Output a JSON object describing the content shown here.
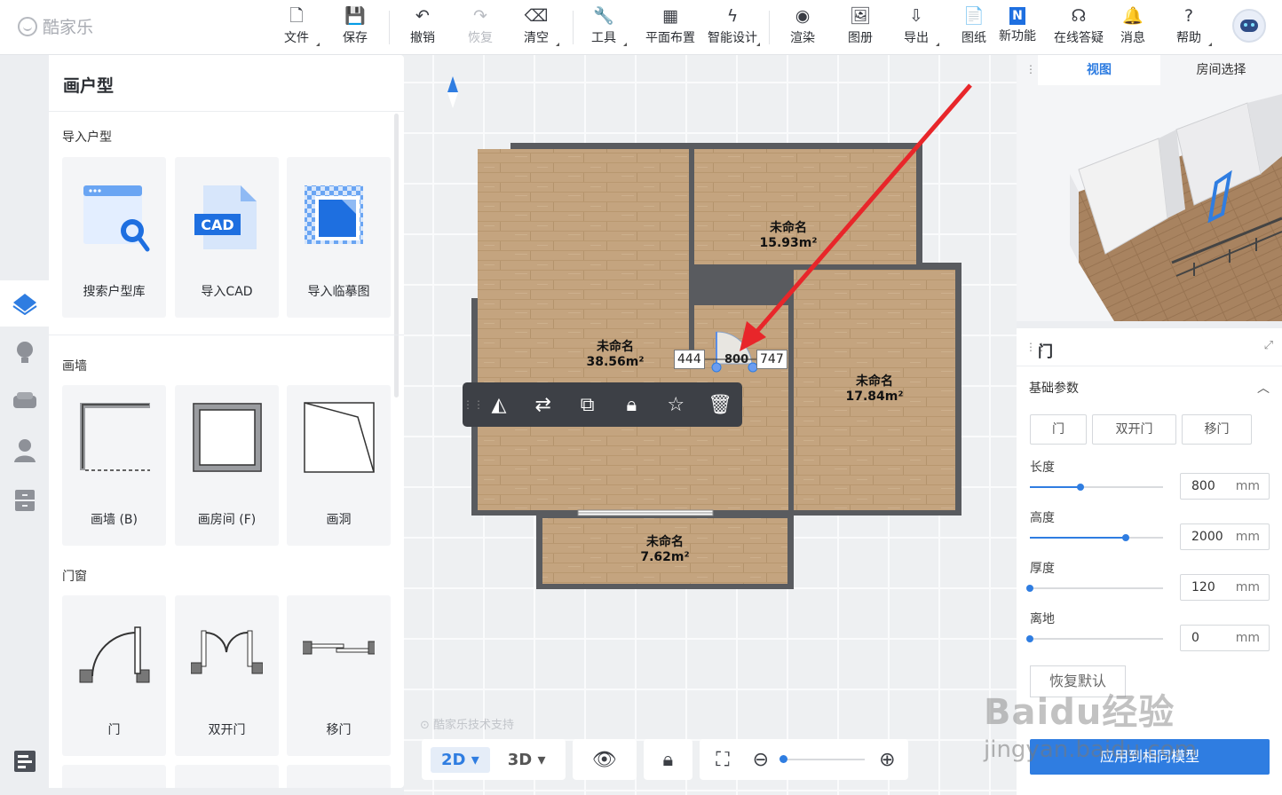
{
  "brand": {
    "name": "酷家乐"
  },
  "toolbar": [
    {
      "id": "file",
      "label": "文件",
      "icon": "file-icon",
      "glyph": "🗋",
      "dropdown": true
    },
    {
      "id": "save",
      "label": "保存",
      "icon": "save-icon",
      "glyph": "💾",
      "dropdown": false
    },
    {
      "id": "undo",
      "label": "撤销",
      "icon": "undo-icon",
      "glyph": "↶",
      "dropdown": false
    },
    {
      "id": "redo",
      "label": "恢复",
      "icon": "redo-icon",
      "glyph": "↷",
      "dropdown": false,
      "disabled": true
    },
    {
      "id": "clear",
      "label": "清空",
      "icon": "eraser-icon",
      "glyph": "⌫",
      "dropdown": true
    },
    {
      "id": "tools",
      "label": "工具",
      "icon": "wrench-icon",
      "glyph": "🔧",
      "dropdown": true
    },
    {
      "id": "layout",
      "label": "平面布置",
      "icon": "layout-icon",
      "glyph": "▦",
      "dropdown": false
    },
    {
      "id": "smart",
      "label": "智能设计",
      "icon": "lightning-icon",
      "glyph": "ϟ",
      "dropdown": true
    },
    {
      "id": "render",
      "label": "渲染",
      "icon": "camera-icon",
      "glyph": "◉",
      "dropdown": false
    },
    {
      "id": "album",
      "label": "图册",
      "icon": "image-icon",
      "glyph": "🖼",
      "dropdown": false
    },
    {
      "id": "export",
      "label": "导出",
      "icon": "export-icon",
      "glyph": "⇩",
      "dropdown": true
    },
    {
      "id": "drawings",
      "label": "图纸",
      "icon": "drawing-icon",
      "glyph": "📄",
      "dropdown": false
    },
    {
      "id": "new",
      "label": "新功能",
      "icon": "new-badge-icon",
      "glyph": "N",
      "dropdown": false
    },
    {
      "id": "support",
      "label": "在线答疑",
      "icon": "headset-icon",
      "glyph": "☊",
      "dropdown": false
    },
    {
      "id": "messages",
      "label": "消息",
      "icon": "bell-icon",
      "glyph": "🔔",
      "dropdown": false
    },
    {
      "id": "help",
      "label": "帮助",
      "icon": "help-icon",
      "glyph": "?",
      "dropdown": true
    }
  ],
  "left_panel": {
    "title": "画户型",
    "sections": [
      {
        "title": "导入户型",
        "items": [
          {
            "label": "搜索户型库",
            "icon": "search-floorplan-icon"
          },
          {
            "label": "导入CAD",
            "icon": "cad-icon",
            "badge": "CAD"
          },
          {
            "label": "导入临摹图",
            "icon": "trace-image-icon"
          }
        ]
      },
      {
        "title": "画墙",
        "items": [
          {
            "label": "画墙 (B)",
            "icon": "draw-wall-icon"
          },
          {
            "label": "画房间 (F)",
            "icon": "draw-room-icon"
          },
          {
            "label": "画洞",
            "icon": "draw-opening-icon"
          }
        ]
      },
      {
        "title": "门窗",
        "items": [
          {
            "label": "门",
            "icon": "door-icon"
          },
          {
            "label": "双开门",
            "icon": "double-door-icon"
          },
          {
            "label": "移门",
            "icon": "sliding-door-icon"
          }
        ]
      }
    ]
  },
  "canvas": {
    "rooms": [
      {
        "name": "未命名",
        "area": "15.93m²"
      },
      {
        "name": "未命名",
        "area": "38.56m²"
      },
      {
        "name": "未命名",
        "area": "17.84m²"
      },
      {
        "name": "未命名",
        "area": "7.62m²"
      }
    ],
    "dimensions": {
      "left": "444",
      "door": "800",
      "right": "747"
    },
    "watermark": "酷家乐技术支持",
    "view_modes": [
      "2D",
      "3D"
    ],
    "active_view": "2D"
  },
  "right_panel": {
    "tabs": [
      "视图",
      "房间选择"
    ],
    "active_tab": "视图",
    "props": {
      "title": "门",
      "section": "基础参数",
      "types": [
        "门",
        "双开门",
        "移门"
      ],
      "params": [
        {
          "label": "长度",
          "value": "800",
          "unit": "mm",
          "level": 0.38
        },
        {
          "label": "高度",
          "value": "2000",
          "unit": "mm",
          "level": 0.72
        },
        {
          "label": "厚度",
          "value": "120",
          "unit": "mm",
          "level": 0.0
        },
        {
          "label": "离地",
          "value": "0",
          "unit": "mm",
          "level": 0.0
        }
      ],
      "restore_label": "恢复默认",
      "apply_label": "应用到相同模型"
    }
  },
  "watermark": {
    "line1": "Baidu经验",
    "line2": "jingyan.baidu.com"
  },
  "colors": {
    "accent": "#2f7de1",
    "arrow": "#e8262a",
    "wall": "#595b5f"
  }
}
